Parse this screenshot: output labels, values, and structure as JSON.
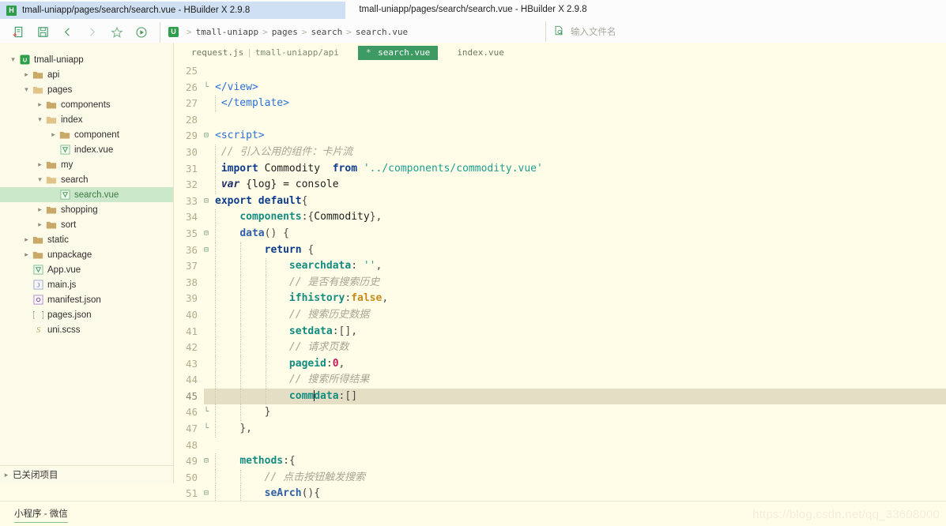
{
  "window": {
    "tab_title": "tmall-uniapp/pages/search/search.vue - HBuilder X 2.9.8",
    "center_title": "tmall-uniapp/pages/search/search.vue - HBuilder X 2.9.8",
    "logo_letter": "H"
  },
  "toolbar": {
    "icons": [
      {
        "name": "new-file-icon",
        "label": "新建"
      },
      {
        "name": "save-icon",
        "label": "保存"
      },
      {
        "name": "back-icon",
        "label": "后退"
      },
      {
        "name": "forward-icon",
        "label": "前进"
      },
      {
        "name": "favorite-star-icon",
        "label": "收藏"
      },
      {
        "name": "run-icon",
        "label": "运行"
      }
    ],
    "project_badge": "U",
    "breadcrumb": [
      "tmall-uniapp",
      "pages",
      "search",
      "search.vue"
    ],
    "breadcrumb_separator": ">",
    "search_placeholder": "输入文件名",
    "search_icon": "file-search-icon"
  },
  "sidebar": {
    "tree": [
      {
        "label": "tmall-uniapp",
        "depth": 0,
        "arrow": "down",
        "icon": "project-icon"
      },
      {
        "label": "api",
        "depth": 1,
        "arrow": "right",
        "icon": "folder-closed-icon"
      },
      {
        "label": "pages",
        "depth": 1,
        "arrow": "down",
        "icon": "folder-open-icon"
      },
      {
        "label": "components",
        "depth": 2,
        "arrow": "right",
        "icon": "folder-closed-icon"
      },
      {
        "label": "index",
        "depth": 2,
        "arrow": "down",
        "icon": "folder-open-icon"
      },
      {
        "label": "component",
        "depth": 3,
        "arrow": "right",
        "icon": "folder-closed-icon"
      },
      {
        "label": "index.vue",
        "depth": 3,
        "arrow": "none",
        "icon": "vue-file-icon"
      },
      {
        "label": "my",
        "depth": 2,
        "arrow": "right",
        "icon": "folder-closed-icon"
      },
      {
        "label": "search",
        "depth": 2,
        "arrow": "down",
        "icon": "folder-open-icon"
      },
      {
        "label": "search.vue",
        "depth": 3,
        "arrow": "none",
        "icon": "vue-file-icon",
        "selected": true
      },
      {
        "label": "shopping",
        "depth": 2,
        "arrow": "right",
        "icon": "folder-closed-icon"
      },
      {
        "label": "sort",
        "depth": 2,
        "arrow": "right",
        "icon": "folder-closed-icon"
      },
      {
        "label": "static",
        "depth": 1,
        "arrow": "right",
        "icon": "folder-closed-icon"
      },
      {
        "label": "unpackage",
        "depth": 1,
        "arrow": "right",
        "icon": "folder-closed-icon"
      },
      {
        "label": "App.vue",
        "depth": 1,
        "arrow": "none",
        "icon": "vue-file-icon"
      },
      {
        "label": "main.js",
        "depth": 1,
        "arrow": "none",
        "icon": "js-file-icon"
      },
      {
        "label": "manifest.json",
        "depth": 1,
        "arrow": "none",
        "icon": "manifest-file-icon"
      },
      {
        "label": "pages.json",
        "depth": 1,
        "arrow": "none",
        "icon": "json-file-icon"
      },
      {
        "label": "uni.scss",
        "depth": 1,
        "arrow": "none",
        "icon": "scss-file-icon"
      }
    ],
    "closed_projects_label": "已关闭项目",
    "closed_projects_arrow": "right"
  },
  "editor": {
    "tabs": [
      {
        "label": "request.js",
        "path": "tmall-uniapp/api",
        "active": false,
        "dirty": false
      },
      {
        "label": "search.vue",
        "path": "",
        "active": true,
        "dirty": true
      },
      {
        "label": "index.vue",
        "path": "",
        "active": false,
        "dirty": false
      }
    ],
    "first_line_number": 25,
    "current_line": 45,
    "lines": [
      {
        "n": 25,
        "fold": "",
        "tokens": []
      },
      {
        "n": 26,
        "fold": "└",
        "tokens": [
          {
            "t": "tag",
            "v": "</view>"
          }
        ]
      },
      {
        "n": 27,
        "fold": "",
        "tokens": [
          {
            "t": "sp",
            "v": " "
          },
          {
            "t": "tag",
            "v": "</template>"
          }
        ]
      },
      {
        "n": 28,
        "fold": "",
        "tokens": []
      },
      {
        "n": 29,
        "fold": "⊟",
        "tokens": [
          {
            "t": "tag",
            "v": "<script>"
          }
        ]
      },
      {
        "n": 30,
        "fold": "",
        "tokens": [
          {
            "t": "sp",
            "v": " "
          },
          {
            "t": "comment",
            "v": "// 引入公用的组件：卡片流"
          }
        ]
      },
      {
        "n": 31,
        "fold": "",
        "tokens": [
          {
            "t": "sp",
            "v": " "
          },
          {
            "t": "kw2",
            "v": "import"
          },
          {
            "t": "plain",
            "v": " Commodity  "
          },
          {
            "t": "kw2",
            "v": "from"
          },
          {
            "t": "plain",
            "v": " "
          },
          {
            "t": "str",
            "v": "'../components/commodity.vue'"
          }
        ]
      },
      {
        "n": 32,
        "fold": "",
        "tokens": [
          {
            "t": "sp",
            "v": " "
          },
          {
            "t": "italic",
            "v": "var"
          },
          {
            "t": "plain",
            "v": " {log} = console"
          }
        ]
      },
      {
        "n": 33,
        "fold": "⊟",
        "tokens": [
          {
            "t": "kw2",
            "v": "export"
          },
          {
            "t": "plain",
            "v": " "
          },
          {
            "t": "kw2",
            "v": "default"
          },
          {
            "t": "punct",
            "v": "{"
          }
        ]
      },
      {
        "n": 34,
        "fold": "",
        "tokens": [
          {
            "t": "sp",
            "v": "    "
          },
          {
            "t": "prop",
            "v": "components"
          },
          {
            "t": "punct",
            "v": ":{"
          },
          {
            "t": "plain",
            "v": "Commodity"
          },
          {
            "t": "punct",
            "v": "},"
          }
        ]
      },
      {
        "n": 35,
        "fold": "⊟",
        "tokens": [
          {
            "t": "sp",
            "v": "    "
          },
          {
            "t": "fn",
            "v": "data"
          },
          {
            "t": "punct",
            "v": "() {"
          }
        ]
      },
      {
        "n": 36,
        "fold": "⊟",
        "tokens": [
          {
            "t": "sp",
            "v": "        "
          },
          {
            "t": "kw2",
            "v": "return"
          },
          {
            "t": "punct",
            "v": " {"
          }
        ]
      },
      {
        "n": 37,
        "fold": "",
        "tokens": [
          {
            "t": "sp",
            "v": "            "
          },
          {
            "t": "prop",
            "v": "searchdata"
          },
          {
            "t": "punct",
            "v": ": "
          },
          {
            "t": "str",
            "v": "''"
          },
          {
            "t": "punct",
            "v": ","
          }
        ]
      },
      {
        "n": 38,
        "fold": "",
        "tokens": [
          {
            "t": "sp",
            "v": "            "
          },
          {
            "t": "comment",
            "v": "// 是否有搜索历史"
          }
        ]
      },
      {
        "n": 39,
        "fold": "",
        "tokens": [
          {
            "t": "sp",
            "v": "            "
          },
          {
            "t": "prop",
            "v": "ifhistory"
          },
          {
            "t": "punct",
            "v": ":"
          },
          {
            "t": "bool",
            "v": "false"
          },
          {
            "t": "punct",
            "v": ","
          }
        ]
      },
      {
        "n": 40,
        "fold": "",
        "tokens": [
          {
            "t": "sp",
            "v": "            "
          },
          {
            "t": "comment",
            "v": "// 搜索历史数据"
          }
        ]
      },
      {
        "n": 41,
        "fold": "",
        "tokens": [
          {
            "t": "sp",
            "v": "            "
          },
          {
            "t": "prop",
            "v": "setdata"
          },
          {
            "t": "punct",
            "v": ":[],"
          }
        ]
      },
      {
        "n": 42,
        "fold": "",
        "tokens": [
          {
            "t": "sp",
            "v": "            "
          },
          {
            "t": "comment",
            "v": "// 请求页数"
          }
        ]
      },
      {
        "n": 43,
        "fold": "",
        "tokens": [
          {
            "t": "sp",
            "v": "            "
          },
          {
            "t": "prop",
            "v": "pageid"
          },
          {
            "t": "punct",
            "v": ":"
          },
          {
            "t": "num",
            "v": "0"
          },
          {
            "t": "punct",
            "v": ","
          }
        ]
      },
      {
        "n": 44,
        "fold": "",
        "tokens": [
          {
            "t": "sp",
            "v": "            "
          },
          {
            "t": "comment",
            "v": "// 搜索所得结果"
          }
        ]
      },
      {
        "n": 45,
        "fold": "",
        "current": true,
        "tokens": [
          {
            "t": "sp",
            "v": "            "
          },
          {
            "t": "prop",
            "v": "comm"
          },
          {
            "t": "caret",
            "v": ""
          },
          {
            "t": "prop",
            "v": "data"
          },
          {
            "t": "punct",
            "v": ":[]"
          }
        ]
      },
      {
        "n": 46,
        "fold": "└",
        "tokens": [
          {
            "t": "sp",
            "v": "        "
          },
          {
            "t": "punct",
            "v": "}"
          }
        ]
      },
      {
        "n": 47,
        "fold": "└",
        "tokens": [
          {
            "t": "sp",
            "v": "    "
          },
          {
            "t": "punct",
            "v": "},"
          }
        ]
      },
      {
        "n": 48,
        "fold": "",
        "tokens": []
      },
      {
        "n": 49,
        "fold": "⊟",
        "tokens": [
          {
            "t": "sp",
            "v": "    "
          },
          {
            "t": "prop",
            "v": "methods"
          },
          {
            "t": "punct",
            "v": ":{"
          }
        ]
      },
      {
        "n": 50,
        "fold": "",
        "tokens": [
          {
            "t": "sp",
            "v": "        "
          },
          {
            "t": "comment",
            "v": "// 点击按钮触发搜索"
          }
        ]
      },
      {
        "n": 51,
        "fold": "⊟",
        "tokens": [
          {
            "t": "sp",
            "v": "        "
          },
          {
            "t": "fn",
            "v": "seArch"
          },
          {
            "t": "punct",
            "v": "(){"
          }
        ]
      }
    ]
  },
  "statusbar": {
    "wechat_label": "小程序 - 微信",
    "watermark": "https://blog.csdn.net/qq_33608000"
  },
  "colors": {
    "accent_green": "#3D9A63",
    "editor_bg": "#FFFDE8",
    "sidebar_bg": "#FCFBE9",
    "selection_green": "#CCE8CB",
    "current_line": "#E3DEC4",
    "titlebar_tab": "#CFE0F2"
  }
}
